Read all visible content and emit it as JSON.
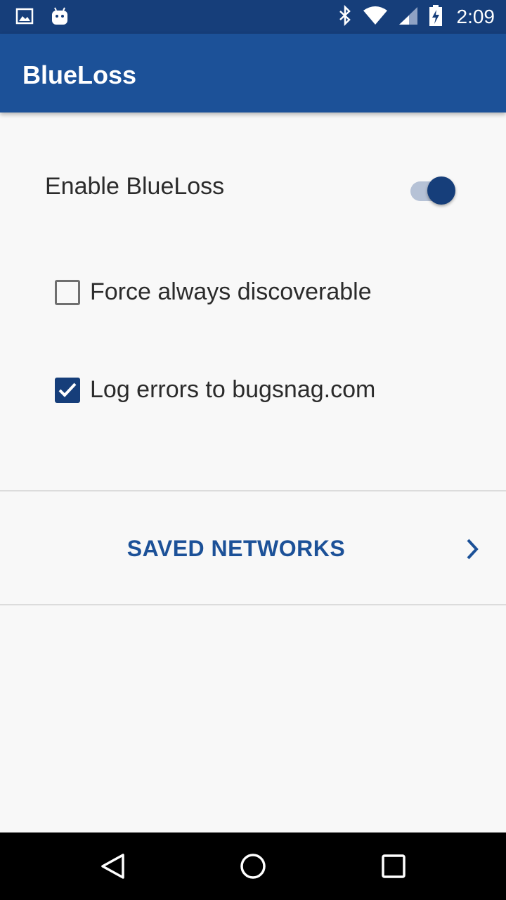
{
  "status_bar": {
    "time": "2:09",
    "icons": [
      "image-notification-icon",
      "android-notification-icon",
      "bluetooth-icon",
      "wifi-icon",
      "cellular-signal-icon",
      "battery-charging-icon"
    ]
  },
  "app_bar": {
    "title": "BlueLoss"
  },
  "settings": {
    "enable": {
      "label": "Enable BlueLoss",
      "on": true
    },
    "discoverable": {
      "label": "Force always discoverable",
      "checked": false
    },
    "log_errors": {
      "label": "Log errors to bugsnag.com",
      "checked": true
    }
  },
  "saved_networks": {
    "label": "SAVED NETWORKS",
    "icon": "chevron-right-icon"
  },
  "nav_bar": {
    "icons": [
      "back-icon",
      "home-icon",
      "recents-icon"
    ]
  },
  "colors": {
    "status_bar": "#163e7a",
    "app_bar": "#1c5198",
    "accent": "#163e7a",
    "background": "#f8f8f8"
  }
}
